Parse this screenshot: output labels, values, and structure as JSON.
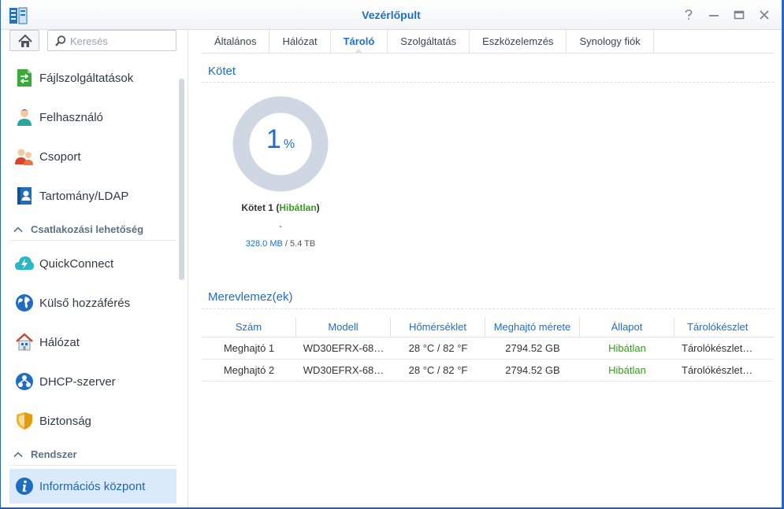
{
  "window": {
    "title": "Vezérlőpult",
    "buttons": [
      "help-icon",
      "minimize-icon",
      "maximize-icon",
      "close-icon"
    ]
  },
  "search": {
    "placeholder": "Keresés"
  },
  "sidebar": {
    "items": [
      {
        "label": "Fájlszolgáltatások",
        "icon": "file-services-icon"
      },
      {
        "label": "Felhasználó",
        "icon": "user-icon"
      },
      {
        "label": "Csoport",
        "icon": "group-icon"
      },
      {
        "label": "Tartomány/LDAP",
        "icon": "domain-ldap-icon"
      }
    ],
    "section_connectivity": "Csatlakozási lehetőség",
    "connectivity_items": [
      {
        "label": "QuickConnect",
        "icon": "quickconnect-icon"
      },
      {
        "label": "Külső hozzáférés",
        "icon": "external-access-icon"
      },
      {
        "label": "Hálózat",
        "icon": "network-icon"
      },
      {
        "label": "DHCP-szerver",
        "icon": "dhcp-server-icon"
      },
      {
        "label": "Biztonság",
        "icon": "security-shield-icon"
      }
    ],
    "section_system": "Rendszer",
    "system_items": [
      {
        "label": "Információs központ",
        "icon": "info-icon",
        "active": true
      }
    ]
  },
  "tabs": [
    "Általános",
    "Hálózat",
    "Tároló",
    "Szolgáltatás",
    "Eszközelemzés",
    "Synology fiók"
  ],
  "active_tab": "Tároló",
  "volume_section": {
    "title": "Kötet",
    "percent": "1",
    "percent_unit": "%",
    "name": "Kötet 1",
    "status": "Hibátlan",
    "dash": "-",
    "used": "328.0 MB",
    "total": "5.4 TB"
  },
  "disk_section": {
    "title": "Merevlemez(ek)",
    "columns": [
      "Szám",
      "Modell",
      "Hőmérséklet",
      "Meghajtó mérete",
      "Állapot",
      "Tárolókészlet"
    ],
    "rows": [
      [
        "Meghajtó 1",
        "WD30EFRX-68…",
        "28 °C / 82 °F",
        "2794.52 GB",
        "Hibátlan",
        "Tárolókészlet…"
      ],
      [
        "Meghajtó 2",
        "WD30EFRX-68…",
        "28 °C / 82 °F",
        "2794.52 GB",
        "Hibátlan",
        "Tárolókészlet…"
      ]
    ]
  },
  "colors": {
    "accent": "#1c6fc4",
    "ok": "#3a9a27",
    "donut_track": "#cfd8e2",
    "active_nav_bg": "#dbeafb"
  }
}
